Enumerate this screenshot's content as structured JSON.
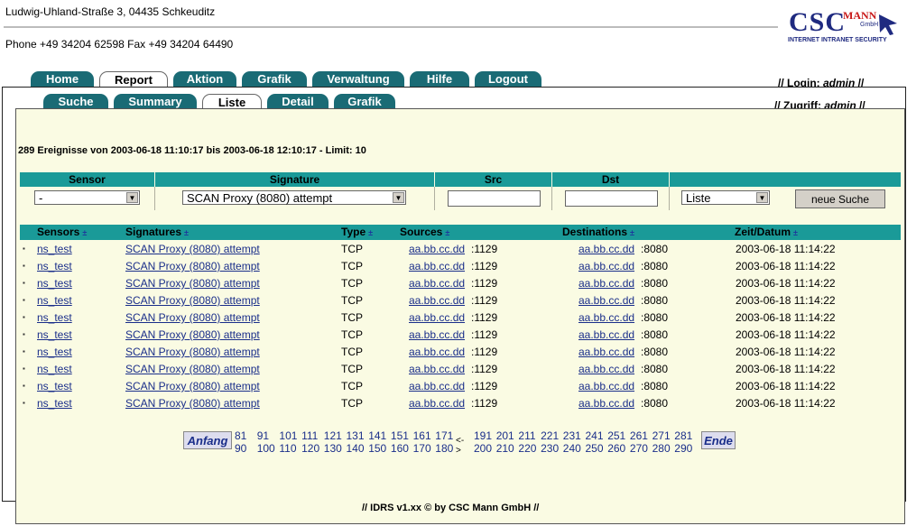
{
  "header": {
    "address": "Ludwig-Uhland-Straße 3, 04435 Schkeuditz",
    "phone": "Phone +49 34204 62598 Fax +49 34204 64490",
    "logo": {
      "csc": "CSC",
      "mann": "MANN",
      "gmbh": "GmbH",
      "tagline": "INTERNET INTRANET SECURITY"
    }
  },
  "main_tabs": [
    "Home",
    "Report",
    "Aktion",
    "Grafik",
    "Verwaltung",
    "Hilfe",
    "Logout"
  ],
  "sub_tabs": [
    "Suche",
    "Summary",
    "Liste",
    "Detail",
    "Grafik"
  ],
  "login": {
    "prefix": "// Login: ",
    "user": "admin",
    "suffix": " //"
  },
  "zugriff": {
    "prefix": "// Zugriff: ",
    "level": "admin",
    "suffix": " //"
  },
  "summary": "289 Ereignisse von 2003-06-18 11:10:17 bis 2003-06-18 12:10:17 - Limit: 10",
  "filter": {
    "headers": [
      "Sensor",
      "Signature",
      "Src",
      "Dst",
      ""
    ],
    "sensor_value": "-",
    "signature_value": "SCAN Proxy (8080) attempt",
    "src_value": "",
    "dst_value": "",
    "view_value": "Liste",
    "search_button": "neue Suche"
  },
  "results": {
    "headers": [
      "Sensors",
      "Signatures",
      "Type",
      "Sources",
      "Destinations",
      "Zeit/Datum"
    ],
    "sort_glyph": "±",
    "rows": [
      {
        "sensor": "ns_test",
        "signature": "SCAN Proxy (8080) attempt",
        "type": "TCP",
        "src": "aa.bb.cc.dd",
        "sport": ":1129",
        "dst": "aa.bb.cc.dd",
        "dport": ":8080",
        "time": "2003-06-18 11:14:22"
      },
      {
        "sensor": "ns_test",
        "signature": "SCAN Proxy (8080) attempt",
        "type": "TCP",
        "src": "aa.bb.cc.dd",
        "sport": ":1129",
        "dst": "aa.bb.cc.dd",
        "dport": ":8080",
        "time": "2003-06-18 11:14:22"
      },
      {
        "sensor": "ns_test",
        "signature": "SCAN Proxy (8080) attempt",
        "type": "TCP",
        "src": "aa.bb.cc.dd",
        "sport": ":1129",
        "dst": "aa.bb.cc.dd",
        "dport": ":8080",
        "time": "2003-06-18 11:14:22"
      },
      {
        "sensor": "ns_test",
        "signature": "SCAN Proxy (8080) attempt",
        "type": "TCP",
        "src": "aa.bb.cc.dd",
        "sport": ":1129",
        "dst": "aa.bb.cc.dd",
        "dport": ":8080",
        "time": "2003-06-18 11:14:22"
      },
      {
        "sensor": "ns_test",
        "signature": "SCAN Proxy (8080) attempt",
        "type": "TCP",
        "src": "aa.bb.cc.dd",
        "sport": ":1129",
        "dst": "aa.bb.cc.dd",
        "dport": ":8080",
        "time": "2003-06-18 11:14:22"
      },
      {
        "sensor": "ns_test",
        "signature": "SCAN Proxy (8080) attempt",
        "type": "TCP",
        "src": "aa.bb.cc.dd",
        "sport": ":1129",
        "dst": "aa.bb.cc.dd",
        "dport": ":8080",
        "time": "2003-06-18 11:14:22"
      },
      {
        "sensor": "ns_test",
        "signature": "SCAN Proxy (8080) attempt",
        "type": "TCP",
        "src": "aa.bb.cc.dd",
        "sport": ":1129",
        "dst": "aa.bb.cc.dd",
        "dport": ":8080",
        "time": "2003-06-18 11:14:22"
      },
      {
        "sensor": "ns_test",
        "signature": "SCAN Proxy (8080) attempt",
        "type": "TCP",
        "src": "aa.bb.cc.dd",
        "sport": ":1129",
        "dst": "aa.bb.cc.dd",
        "dport": ":8080",
        "time": "2003-06-18 11:14:22"
      },
      {
        "sensor": "ns_test",
        "signature": "SCAN Proxy (8080) attempt",
        "type": "TCP",
        "src": "aa.bb.cc.dd",
        "sport": ":1129",
        "dst": "aa.bb.cc.dd",
        "dport": ":8080",
        "time": "2003-06-18 11:14:22"
      },
      {
        "sensor": "ns_test",
        "signature": "SCAN Proxy (8080) attempt",
        "type": "TCP",
        "src": "aa.bb.cc.dd",
        "sport": ":1129",
        "dst": "aa.bb.cc.dd",
        "dport": ":8080",
        "time": "2003-06-18 11:14:22"
      }
    ]
  },
  "pager": {
    "first": "Anfang",
    "last": "Ende",
    "separator": "<->",
    "left_pages": [
      [
        "81",
        "90"
      ],
      [
        "91",
        "100"
      ],
      [
        "101",
        "110"
      ],
      [
        "111",
        "120"
      ],
      [
        "121",
        "130"
      ],
      [
        "131",
        "140"
      ],
      [
        "141",
        "150"
      ],
      [
        "151",
        "160"
      ],
      [
        "161",
        "170"
      ],
      [
        "171",
        "180"
      ]
    ],
    "right_pages": [
      [
        "191",
        "200"
      ],
      [
        "201",
        "210"
      ],
      [
        "211",
        "220"
      ],
      [
        "221",
        "230"
      ],
      [
        "231",
        "240"
      ],
      [
        "241",
        "250"
      ],
      [
        "251",
        "260"
      ],
      [
        "261",
        "270"
      ],
      [
        "271",
        "280"
      ],
      [
        "281",
        "290"
      ]
    ]
  },
  "footer": "//  IDRS v1.xx © by CSC Mann GmbH   //",
  "colors": {
    "tab": "#1a6b75",
    "header": "#1a9a98",
    "panel": "#fafbe3",
    "link": "#1a2e8a"
  }
}
